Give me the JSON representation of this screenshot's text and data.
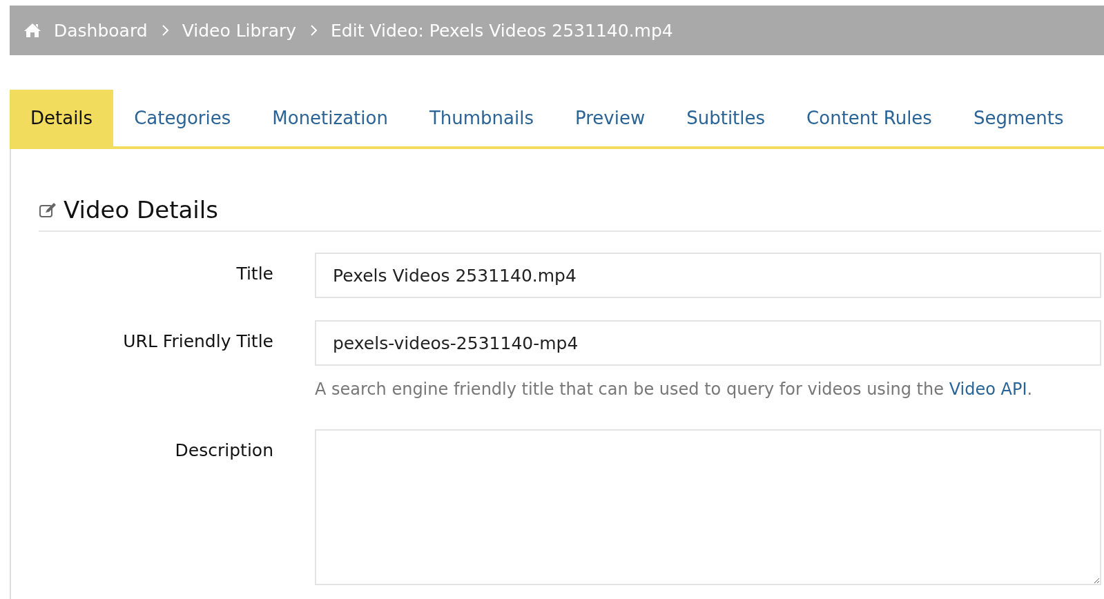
{
  "breadcrumb": [
    {
      "label": "Dashboard",
      "kind": "home"
    },
    {
      "label": "Video Library",
      "kind": "link"
    },
    {
      "label": "Edit Video: Pexels Videos 2531140.mp4",
      "kind": "current"
    }
  ],
  "tabs": [
    {
      "label": "Details",
      "selected": true
    },
    {
      "label": "Categories",
      "selected": false
    },
    {
      "label": "Monetization",
      "selected": false
    },
    {
      "label": "Thumbnails",
      "selected": false
    },
    {
      "label": "Preview",
      "selected": false
    },
    {
      "label": "Subtitles",
      "selected": false
    },
    {
      "label": "Content Rules",
      "selected": false
    },
    {
      "label": "Segments",
      "selected": false
    }
  ],
  "section": {
    "title": "Video Details"
  },
  "fields": [
    {
      "label": "Title",
      "kind": "text",
      "value": "Pexels Videos 2531140.mp4"
    },
    {
      "label": "URL Friendly Title",
      "kind": "text",
      "value": "pexels-videos-2531140-mp4",
      "help": "A search engine friendly title that can be used to query for videos using the ",
      "help_link": "Video API",
      "help_end": "."
    },
    {
      "label": "Description",
      "kind": "textarea"
    }
  ]
}
